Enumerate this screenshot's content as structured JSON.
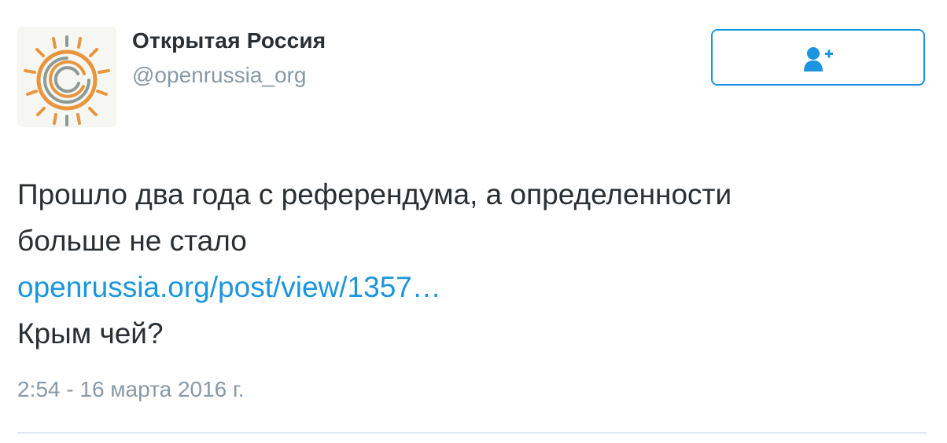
{
  "author": {
    "name": "Открытая Россия",
    "handle": "@openrussia_org",
    "avatar_icon": "sun-logo-icon"
  },
  "follow_button": {
    "icon": "follow-user-plus-icon",
    "color": "#1b95e0"
  },
  "tweet": {
    "text_line_1": "Прошло два года с референдума, а определенности",
    "text_line_2": "больше не стало",
    "link": "openrussia.org/post/view/1357…",
    "text_line_3": "Крым чей?",
    "timestamp": "2:54 - 16 марта 2016 г."
  },
  "colors": {
    "text": "#292f33",
    "muted": "#8899a6",
    "link": "#1b95e0",
    "logo_orange": "#e8963e",
    "logo_gray": "#8e9b94"
  }
}
